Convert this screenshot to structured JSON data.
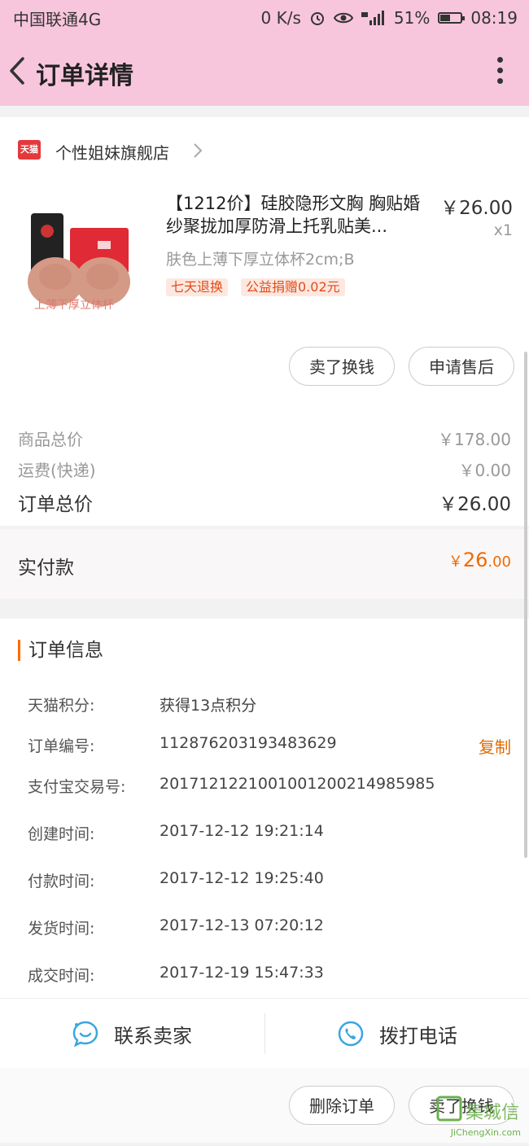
{
  "status_bar": {
    "carrier": "中国联通4G",
    "speed": "0 K/s",
    "battery": "51%",
    "time": "08:19"
  },
  "header": {
    "title": "订单详情"
  },
  "shop": {
    "badge": "天猫",
    "name": "个性姐妹旗舰店"
  },
  "product": {
    "title": "【1212价】硅胶隐形文胸 胸贴婚纱聚拢加厚防滑上托乳贴美...",
    "price": "￥26.00",
    "qty": "x1",
    "sku": "肤色上薄下厚立体杯2cm;B",
    "image_caption": "上薄下厚立体杯",
    "tags": [
      "七天退换",
      "公益捐赠0.02元"
    ],
    "buttons": [
      "卖了换钱",
      "申请售后"
    ]
  },
  "summary": {
    "goods_total_label": "商品总价",
    "goods_total": "￥178.00",
    "shipping_label": "运费(快递)",
    "shipping": "￥0.00",
    "order_total_label": "订单总价",
    "order_total": "￥26.00",
    "paid_label": "实付款",
    "paid_currency": "￥",
    "paid_int": "26",
    "paid_dec": ".00"
  },
  "order_info": {
    "title": "订单信息",
    "copy_label": "复制",
    "rows": [
      {
        "k": "天猫积分:",
        "v": "获得13点积分"
      },
      {
        "k": "订单编号:",
        "v": "112876203193483629"
      },
      {
        "k": "支付宝交易号:",
        "v": "2017121221001001200214985985"
      },
      {
        "k": "创建时间:",
        "v": "2017-12-12 19:21:14"
      },
      {
        "k": "付款时间:",
        "v": "2017-12-12 19:25:40"
      },
      {
        "k": "发货时间:",
        "v": "2017-12-13 07:20:12"
      },
      {
        "k": "成交时间:",
        "v": "2017-12-19 15:47:33"
      }
    ]
  },
  "contact": {
    "seller": "联系卖家",
    "phone": "拨打电话"
  },
  "footer": {
    "buttons": [
      "删除订单",
      "卖了换钱"
    ]
  },
  "watermark": {
    "brand": "集城信",
    "url": "JiChengXin.com"
  },
  "colors": {
    "header_bg": "#f8c6dc",
    "accent": "#f06a00",
    "tag_text": "#e24c1c",
    "link_blue": "#3aa6e0"
  }
}
